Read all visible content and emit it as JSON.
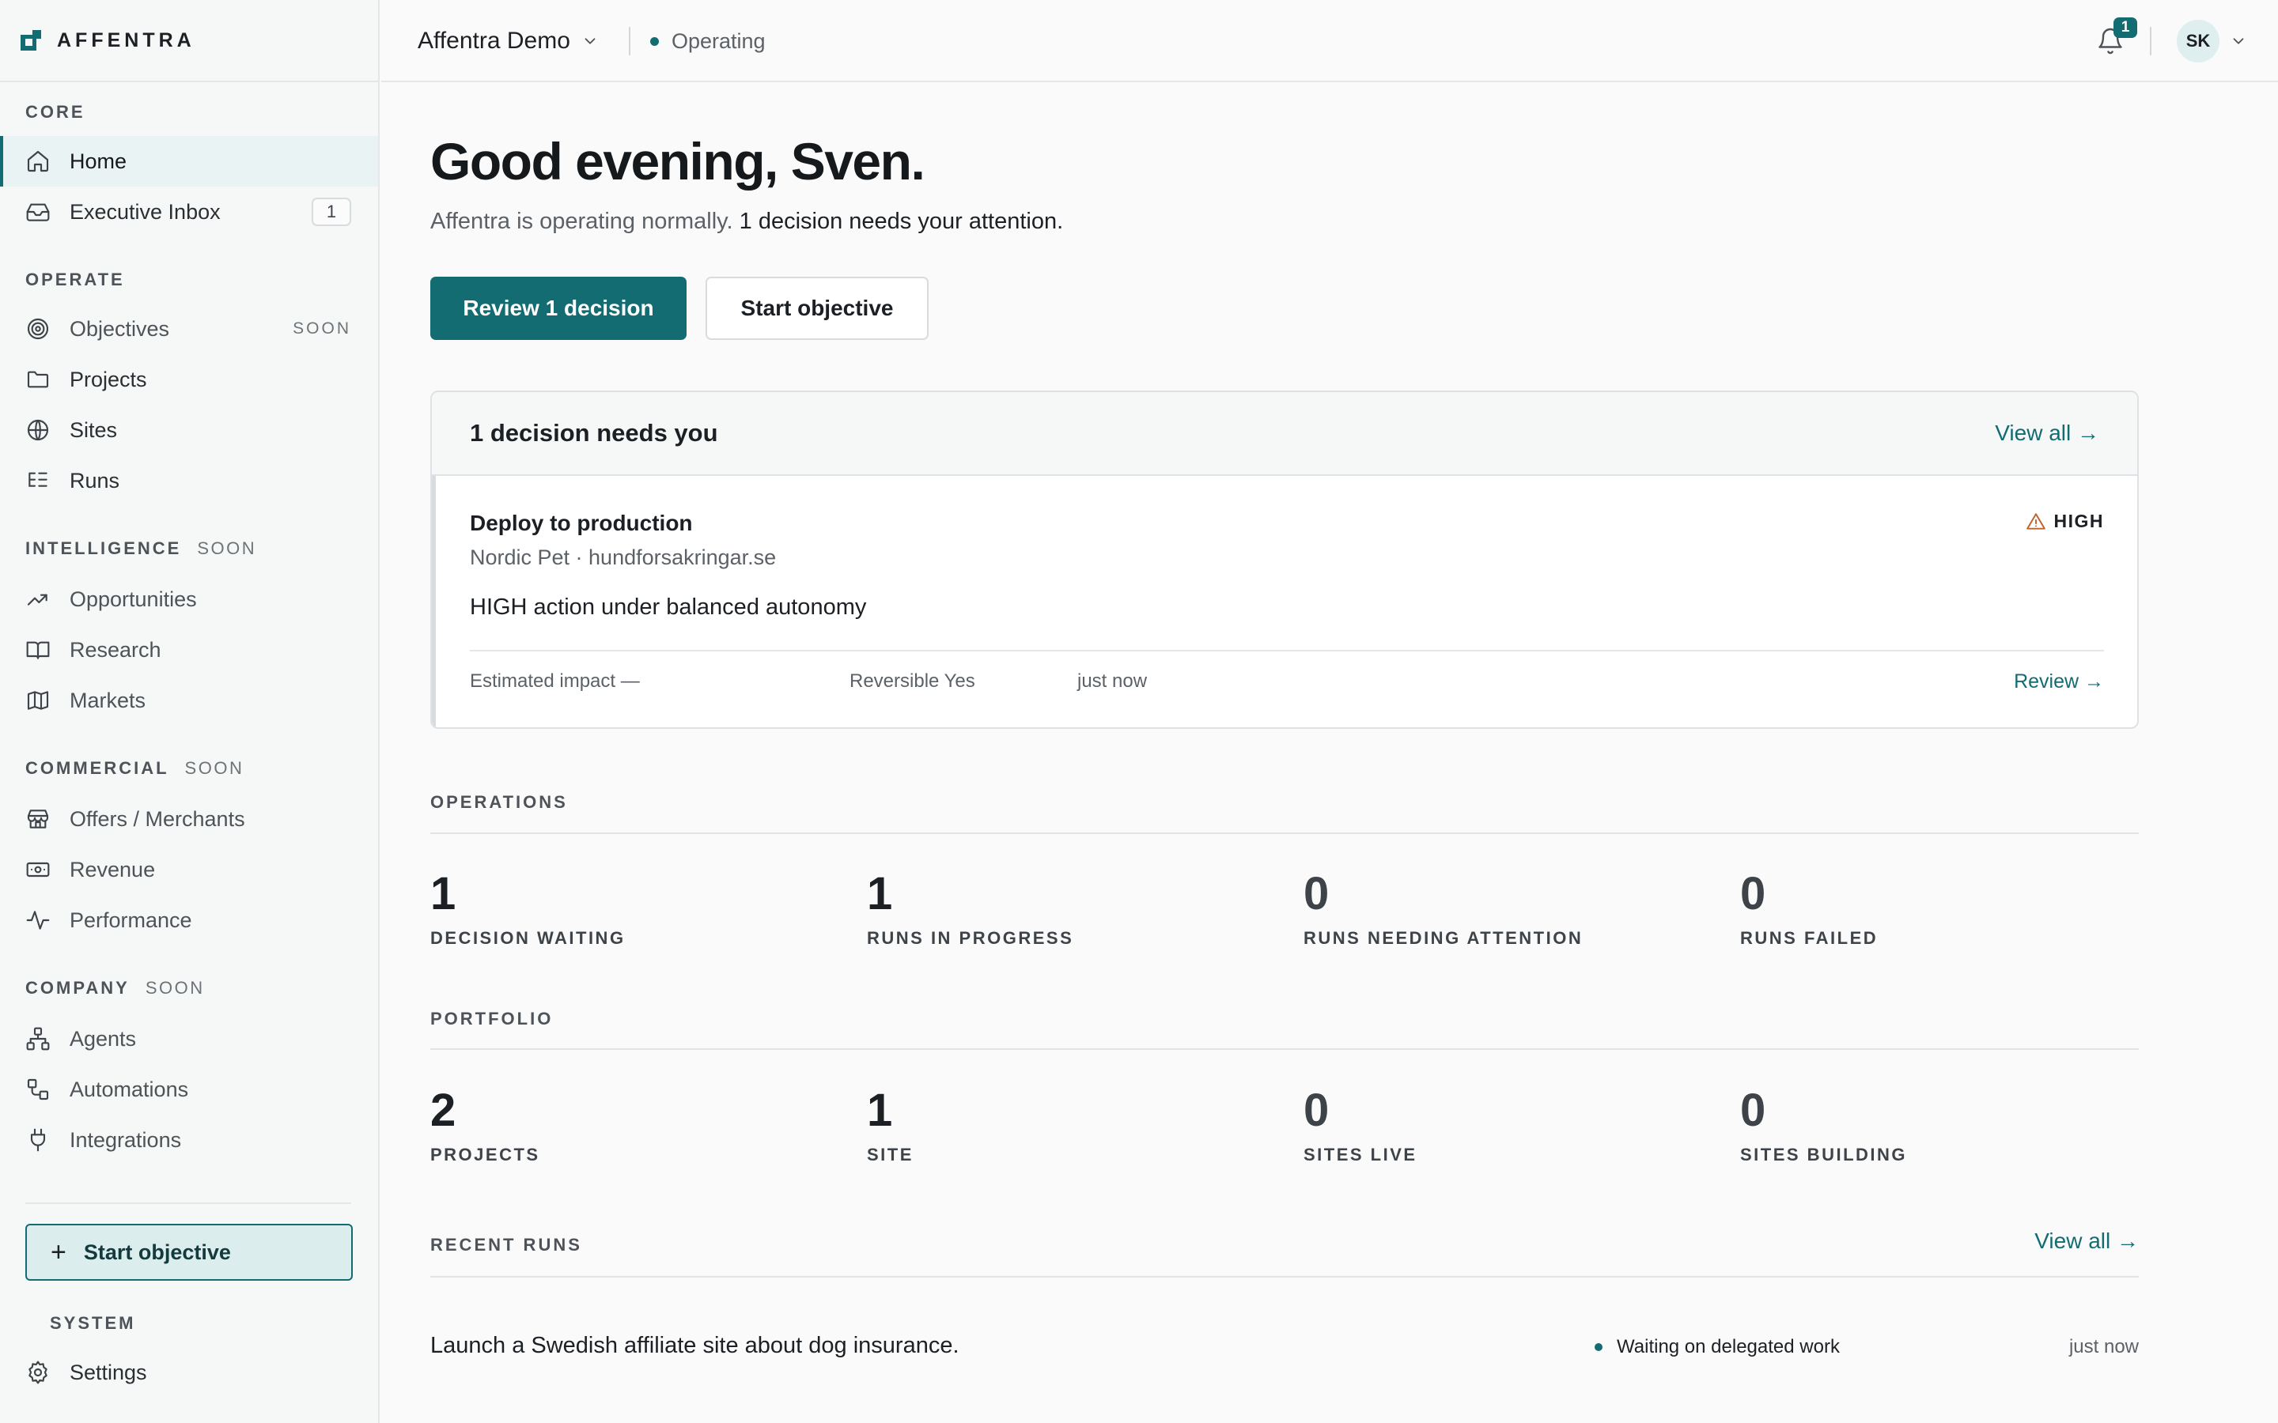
{
  "brand": {
    "name": "AFFENTRA"
  },
  "sidebar": {
    "sections": [
      {
        "label": "CORE",
        "soon": ""
      },
      {
        "label": "OPERATE",
        "soon": ""
      },
      {
        "label": "INTELLIGENCE",
        "soon": "SOON"
      },
      {
        "label": "COMMERCIAL",
        "soon": "SOON"
      },
      {
        "label": "COMPANY",
        "soon": "SOON"
      },
      {
        "label": "SYSTEM",
        "soon": ""
      }
    ],
    "items": [
      {
        "label": "Home",
        "icon": "home-icon"
      },
      {
        "label": "Executive Inbox",
        "icon": "inbox-icon",
        "badge": "1"
      },
      {
        "label": "Objectives",
        "icon": "target-icon",
        "soon": "SOON"
      },
      {
        "label": "Projects",
        "icon": "folder-icon"
      },
      {
        "label": "Sites",
        "icon": "globe-icon"
      },
      {
        "label": "Runs",
        "icon": "list-tree-icon"
      },
      {
        "label": "Opportunities",
        "icon": "trending-up-icon"
      },
      {
        "label": "Research",
        "icon": "book-open-icon"
      },
      {
        "label": "Markets",
        "icon": "map-icon"
      },
      {
        "label": "Offers / Merchants",
        "icon": "store-icon"
      },
      {
        "label": "Revenue",
        "icon": "banknote-icon"
      },
      {
        "label": "Performance",
        "icon": "activity-icon"
      },
      {
        "label": "Agents",
        "icon": "network-icon"
      },
      {
        "label": "Automations",
        "icon": "workflow-icon"
      },
      {
        "label": "Integrations",
        "icon": "plug-icon"
      },
      {
        "label": "Settings",
        "icon": "gear-icon"
      }
    ],
    "start_objective": "Start objective"
  },
  "topbar": {
    "workspace": "Affentra Demo",
    "status": "Operating",
    "notification_count": "1",
    "avatar_initials": "SK"
  },
  "main": {
    "greeting": "Good evening, Sven.",
    "subline_muted": "Affentra is operating normally.",
    "subline_strong": "1 decision needs your attention.",
    "primary_button": "Review 1 decision",
    "secondary_button": "Start objective",
    "decisions": {
      "header": "1 decision needs you",
      "view_all": "View all →",
      "item": {
        "title": "Deploy to production",
        "meta": "Nordic Pet · hundforsakringar.se",
        "severity": "HIGH",
        "description": "HIGH action under balanced autonomy",
        "impact": "Estimated impact —",
        "reversible": "Reversible Yes",
        "time": "just now",
        "review": "Review →"
      }
    },
    "operations": {
      "label": "OPERATIONS",
      "stats": [
        {
          "value": "1",
          "label": "DECISION WAITING"
        },
        {
          "value": "1",
          "label": "RUNS IN PROGRESS"
        },
        {
          "value": "0",
          "label": "RUNS NEEDING ATTENTION"
        },
        {
          "value": "0",
          "label": "RUNS FAILED"
        }
      ]
    },
    "portfolio": {
      "label": "PORTFOLIO",
      "stats": [
        {
          "value": "2",
          "label": "PROJECTS"
        },
        {
          "value": "1",
          "label": "SITE"
        },
        {
          "value": "0",
          "label": "SITES LIVE"
        },
        {
          "value": "0",
          "label": "SITES BUILDING"
        }
      ]
    },
    "recent_runs": {
      "label": "RECENT RUNS",
      "view_all": "View all →",
      "rows": [
        {
          "text": "Launch a Swedish affiliate site about dog insurance.",
          "status": "Waiting on delegated work",
          "time": "just now"
        }
      ]
    }
  },
  "colors": {
    "accent": "#136c72",
    "accent_light": "#dcedee",
    "warning": "#c0632a"
  }
}
